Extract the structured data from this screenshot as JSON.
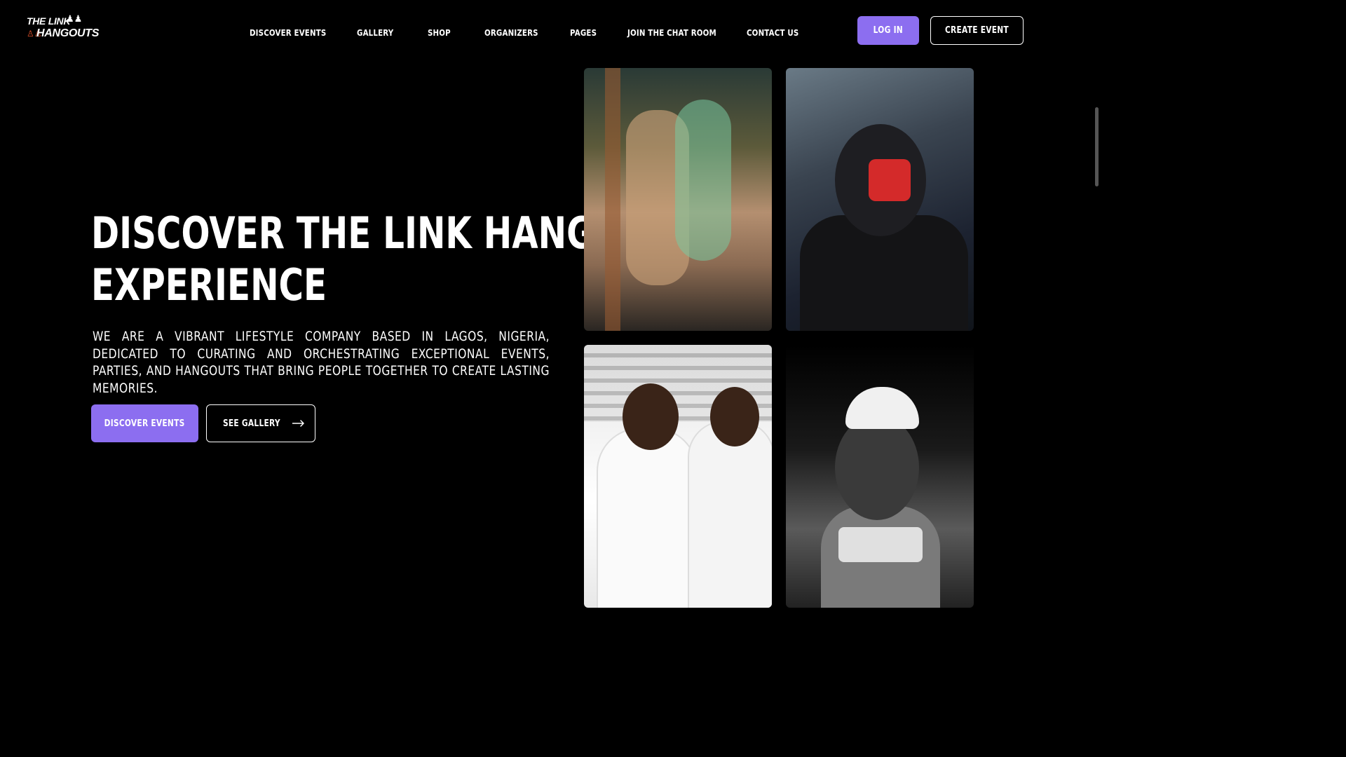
{
  "brand": {
    "line1": "THE LINK",
    "line2": "HANGOUTS",
    "icons": "♙♙",
    "pawns": "♟♟"
  },
  "nav": {
    "items": [
      {
        "label": "DISCOVER EVENTS"
      },
      {
        "label": "GALLERY"
      },
      {
        "label": "SHOP"
      },
      {
        "label": "ORGANIZERS"
      },
      {
        "label": "PAGES"
      },
      {
        "label": "JOIN THE CHAT ROOM"
      },
      {
        "label": "CONTACT US"
      }
    ],
    "login_label": "LOG IN",
    "create_label": "CREATE EVENT"
  },
  "hero": {
    "title_line1": "DISCOVER THE LINK HANGOUTS",
    "title_line2": "EXPERIENCE",
    "description": "WE ARE A VIBRANT LIFESTYLE COMPANY BASED IN LAGOS, NIGERIA, DEDICATED TO CURATING AND ORCHESTRATING EXCEPTIONAL EVENTS, PARTIES, AND HANGOUTS THAT BRING PEOPLE TOGETHER TO CREATE LASTING MEMORIES.",
    "primary_button": "DISCOVER EVENTS",
    "secondary_button": "SEE GALLERY",
    "secondary_icon": "arrow-right-icon"
  },
  "colors": {
    "background": "#000000",
    "accent": "#8c6ef0",
    "text": "#ffffff",
    "logo_accent": "#e8542b"
  }
}
